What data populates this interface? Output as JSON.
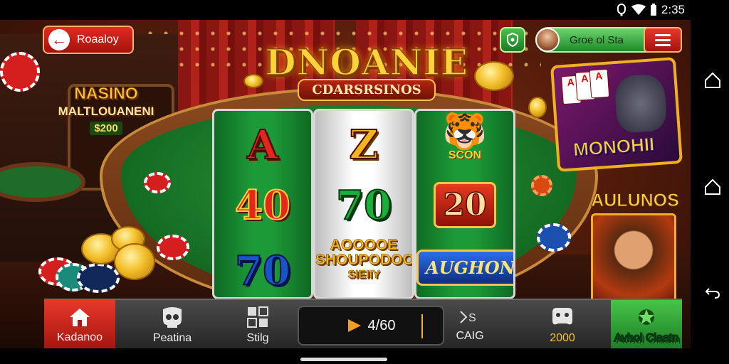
{
  "status_bar": {
    "time": "2:35"
  },
  "header": {
    "back_label": "Roaaloy",
    "user_name": "Groe ol Sta"
  },
  "game": {
    "title": "DNOANIE",
    "subtitle": "CDARSRSINOS",
    "left_sign": {
      "line1": "NASINO",
      "line2": "MALTLOUANENI",
      "line3": "$200"
    },
    "reels": [
      {
        "top": "A",
        "middle": "40",
        "bottom": "70"
      },
      {
        "top": "Z",
        "middle": "70",
        "bottom_lines": [
          "AOOOOE",
          "SHOUPODOOS",
          "SIEIIY"
        ]
      },
      {
        "top": "SCON",
        "middle": "20",
        "bottom": "AUGHONY"
      }
    ],
    "promo_right_top": "MONOHII",
    "promo_right_bottom": "AULUNOS"
  },
  "bottom_bar": {
    "tabs": [
      {
        "label": "Kadanoo",
        "icon": "home-icon"
      },
      {
        "label": "Peatina",
        "icon": "skull-icon"
      },
      {
        "label": "Stilg",
        "icon": "grid-icon"
      },
      {
        "label": "CAIG",
        "icon": "cards-icon"
      },
      {
        "label": "2000",
        "icon": "gamepad-icon"
      },
      {
        "label": "Avhol Claatn",
        "icon": "gift-icon"
      }
    ],
    "bet_value": "4/60"
  },
  "colors": {
    "accent_red": "#d41c14",
    "accent_green": "#1b7a24",
    "gold": "#f5b41c"
  }
}
